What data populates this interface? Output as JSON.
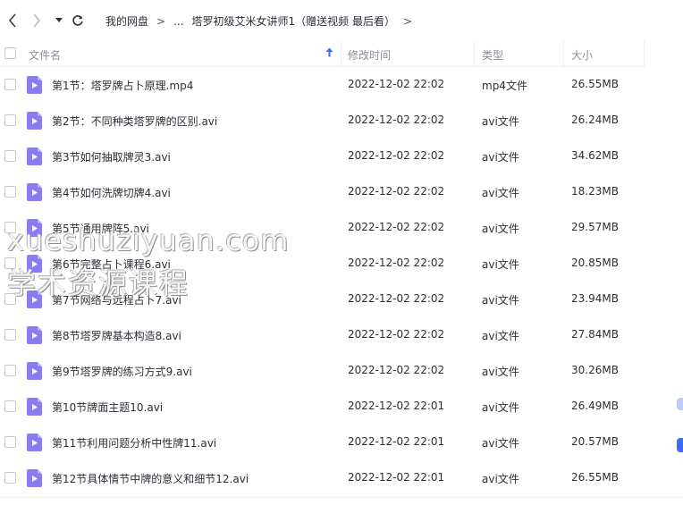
{
  "nav": {
    "breadcrumb": [
      {
        "label": "我的网盘"
      },
      {
        "label": "..."
      },
      {
        "label": "塔罗初级艾米女讲师1（赠送视频 最后看）"
      }
    ],
    "separator": ">"
  },
  "columns": {
    "name": "文件名",
    "time": "修改时间",
    "type": "类型",
    "size": "大小"
  },
  "files": [
    {
      "name": "第1节：塔罗牌占卜原理.mp4",
      "time": "2022-12-02 22:02",
      "type": "mp4文件",
      "size": "26.55MB"
    },
    {
      "name": "第2节：不同种类塔罗牌的区别.avi",
      "time": "2022-12-02 22:02",
      "type": "avi文件",
      "size": "26.24MB"
    },
    {
      "name": "第3节如何抽取牌灵3.avi",
      "time": "2022-12-02 22:02",
      "type": "avi文件",
      "size": "34.62MB"
    },
    {
      "name": "第4节如何洗牌切牌4.avi",
      "time": "2022-12-02 22:02",
      "type": "avi文件",
      "size": "18.23MB"
    },
    {
      "name": "第5节通用牌阵5.avi",
      "time": "2022-12-02 22:02",
      "type": "avi文件",
      "size": "29.57MB"
    },
    {
      "name": "第6节完整占卜课程6.avi",
      "time": "2022-12-02 22:02",
      "type": "avi文件",
      "size": "20.85MB"
    },
    {
      "name": "第7节网络与远程占卜7.avi",
      "time": "2022-12-02 22:02",
      "type": "avi文件",
      "size": "23.94MB"
    },
    {
      "name": "第8节塔罗牌基本构造8.avi",
      "time": "2022-12-02 22:02",
      "type": "avi文件",
      "size": "27.84MB"
    },
    {
      "name": "第9节塔罗牌的练习方式9.avi",
      "time": "2022-12-02 22:02",
      "type": "avi文件",
      "size": "30.26MB"
    },
    {
      "name": "第10节牌面主题10.avi",
      "time": "2022-12-02 22:01",
      "type": "avi文件",
      "size": "26.49MB"
    },
    {
      "name": "第11节利用问题分析中性牌11.avi",
      "time": "2022-12-02 22:01",
      "type": "avi文件",
      "size": "20.57MB"
    },
    {
      "name": "第12节具体情节中牌的意义和细节12.avi",
      "time": "2022-12-02 22:01",
      "type": "avi文件",
      "size": "26.55MB"
    }
  ],
  "watermark": {
    "line1": "xueshuziyuan.com",
    "line2": "学术资源课程"
  },
  "icons": {
    "back": "chevron-left-icon",
    "forward": "chevron-right-icon",
    "history": "caret-down-icon",
    "refresh": "refresh-icon",
    "file": "video-file-icon",
    "sort": "sort-up-arrow-icon"
  },
  "colors": {
    "file_icon": "#8b7cf6",
    "sort_arrow": "#3b6df6",
    "accent": "#3b6df6"
  }
}
